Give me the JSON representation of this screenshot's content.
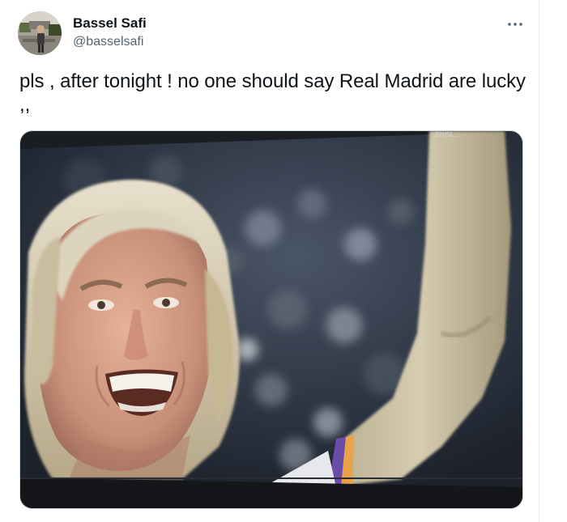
{
  "tweet": {
    "author": {
      "display_name": "Bassel Safi",
      "handle": "@basselsafi",
      "avatar_icon": "user-avatar-photo"
    },
    "more_icon": "more-options-icon",
    "text": "pls , after tonight ! no one should say  Real Madrid are lucky ,,",
    "media": {
      "type": "photo",
      "overlay_text": "ENGL..."
    }
  },
  "colors": {
    "text_primary": "#0f1419",
    "text_secondary": "#536471",
    "border": "#cfd9de"
  }
}
